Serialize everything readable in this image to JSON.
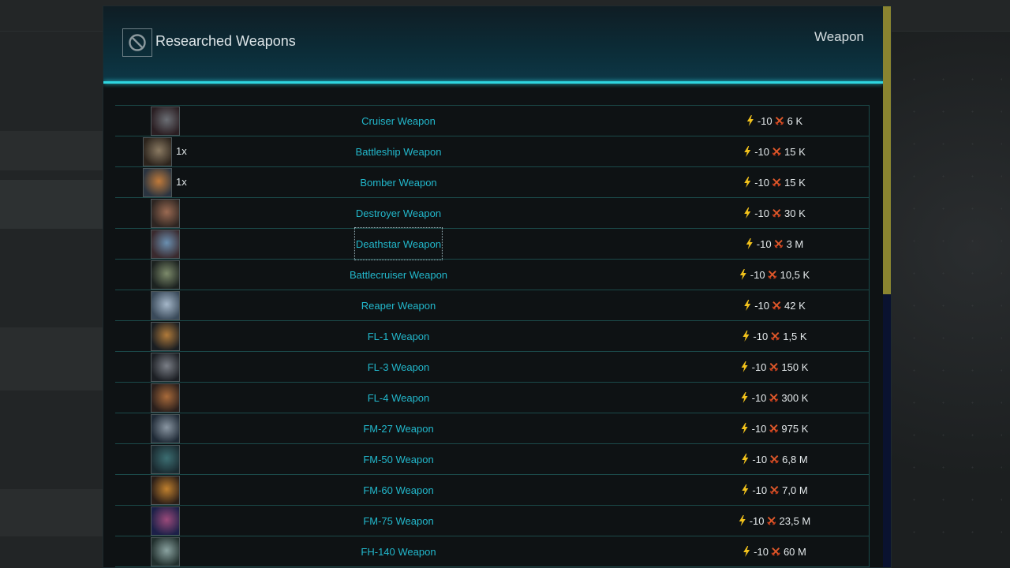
{
  "modal": {
    "title": "Researched Weapons",
    "type_label": "Weapon"
  },
  "colors": {
    "accent": "#2fd6e0",
    "link": "#22b8cc",
    "energy": "#f2c21b",
    "cost": "#e0582a",
    "scrollbar": "#8a8430"
  },
  "weapons": [
    {
      "name": "Cruiser Weapon",
      "qty": "",
      "energy": "-10",
      "cost": "6 K",
      "thumb": [
        "#6b6e74",
        "#2a1e22"
      ]
    },
    {
      "name": "Battleship Weapon",
      "qty": "1x",
      "energy": "-10",
      "cost": "15 K",
      "thumb": [
        "#8a7a62",
        "#2c241d"
      ]
    },
    {
      "name": "Bomber Weapon",
      "qty": "1x",
      "energy": "-10",
      "cost": "15 K",
      "thumb": [
        "#c07a3a",
        "#2a3440"
      ]
    },
    {
      "name": "Destroyer Weapon",
      "qty": "",
      "energy": "-10",
      "cost": "30 K",
      "thumb": [
        "#9a6a52",
        "#2d2522"
      ]
    },
    {
      "name": "Deathstar Weapon",
      "qty": "",
      "energy": "-10",
      "cost": "3 M",
      "thumb": [
        "#6a8fb0",
        "#3a2a2e"
      ]
    },
    {
      "name": "Battlecruiser Weapon",
      "qty": "",
      "energy": "-10",
      "cost": "10,5 K",
      "thumb": [
        "#7c8a6a",
        "#1c2220"
      ]
    },
    {
      "name": "Reaper Weapon",
      "qty": "",
      "energy": "-10",
      "cost": "42 K",
      "thumb": [
        "#a4b6c8",
        "#3a4a5a"
      ]
    },
    {
      "name": "FL-1 Weapon",
      "qty": "",
      "energy": "-10",
      "cost": "1,5 K",
      "thumb": [
        "#b07a3a",
        "#1a1e22"
      ]
    },
    {
      "name": "FL-3 Weapon",
      "qty": "",
      "energy": "-10",
      "cost": "150 K",
      "thumb": [
        "#7a7e86",
        "#1c1f24"
      ]
    },
    {
      "name": "FL-4 Weapon",
      "qty": "",
      "energy": "-10",
      "cost": "300 K",
      "thumb": [
        "#a86a3a",
        "#2a1f1c"
      ]
    },
    {
      "name": "FM-27 Weapon",
      "qty": "",
      "energy": "-10",
      "cost": "975 K",
      "thumb": [
        "#8a96a2",
        "#1f2a36"
      ]
    },
    {
      "name": "FM-50 Weapon",
      "qty": "",
      "energy": "-10",
      "cost": "6,8 M",
      "thumb": [
        "#3c6e72",
        "#1a2a30"
      ]
    },
    {
      "name": "FM-60 Weapon",
      "qty": "",
      "energy": "-10",
      "cost": "7,0 M",
      "thumb": [
        "#c0802e",
        "#2a1e18"
      ]
    },
    {
      "name": "FM-75 Weapon",
      "qty": "",
      "energy": "-10",
      "cost": "23,5 M",
      "thumb": [
        "#9a4a7a",
        "#1c2048"
      ]
    },
    {
      "name": "FH-140 Weapon",
      "qty": "",
      "energy": "-10",
      "cost": "60 M",
      "thumb": [
        "#8aa2a0",
        "#22302e"
      ]
    }
  ]
}
